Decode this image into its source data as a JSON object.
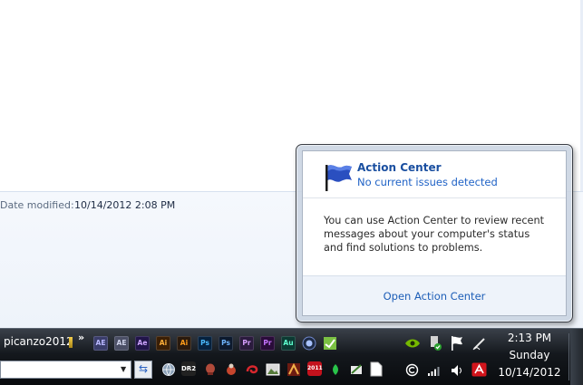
{
  "details": {
    "modified_label": "Date modified:",
    "modified_value": "10/14/2012 2:08 PM"
  },
  "action_center": {
    "title": "Action Center",
    "status": "No current issues detected",
    "description": "You can use Action Center to review recent messages about your computer's status and find solutions to problems.",
    "link": "Open Action Center",
    "flag_color": "#2a4fc0"
  },
  "taskbar": {
    "toolbar_label": "picanzo2012",
    "chevron": "»",
    "quick_launch": [
      {
        "label": "AE",
        "name": "after-effects-icon",
        "bg": "#3a3d6b",
        "fg": "#b9b8ff"
      },
      {
        "label": "AE",
        "name": "after-effects-icon-2",
        "bg": "#4b4f66",
        "fg": "#cfd3ea"
      },
      {
        "label": "Ae",
        "name": "after-effects-cs-icon",
        "bg": "#22154a",
        "fg": "#cfa6ff"
      },
      {
        "label": "Ai",
        "name": "illustrator-icon",
        "bg": "#3b1f05",
        "fg": "#ffb03a"
      },
      {
        "label": "Ai",
        "name": "illustrator-icon-2",
        "bg": "#2a1a0d",
        "fg": "#ff9d1a"
      },
      {
        "label": "Ps",
        "name": "photoshop-icon",
        "bg": "#06223f",
        "fg": "#4bbbff"
      },
      {
        "label": "Ps",
        "name": "photoshop-icon-2",
        "bg": "#0d1a2e",
        "fg": "#6fb5ff"
      },
      {
        "label": "Pr",
        "name": "premiere-icon",
        "bg": "#2b1b3e",
        "fg": "#d7a0ff"
      },
      {
        "label": "Pr",
        "name": "premiere-icon-2",
        "bg": "#2a0c3a",
        "fg": "#c774ff"
      },
      {
        "label": "Au",
        "name": "audition-icon",
        "bg": "#0c3a33",
        "fg": "#5fffd0"
      }
    ],
    "clock": {
      "time": "2:13 PM",
      "day": "Sunday",
      "date": "10/14/2012"
    }
  }
}
